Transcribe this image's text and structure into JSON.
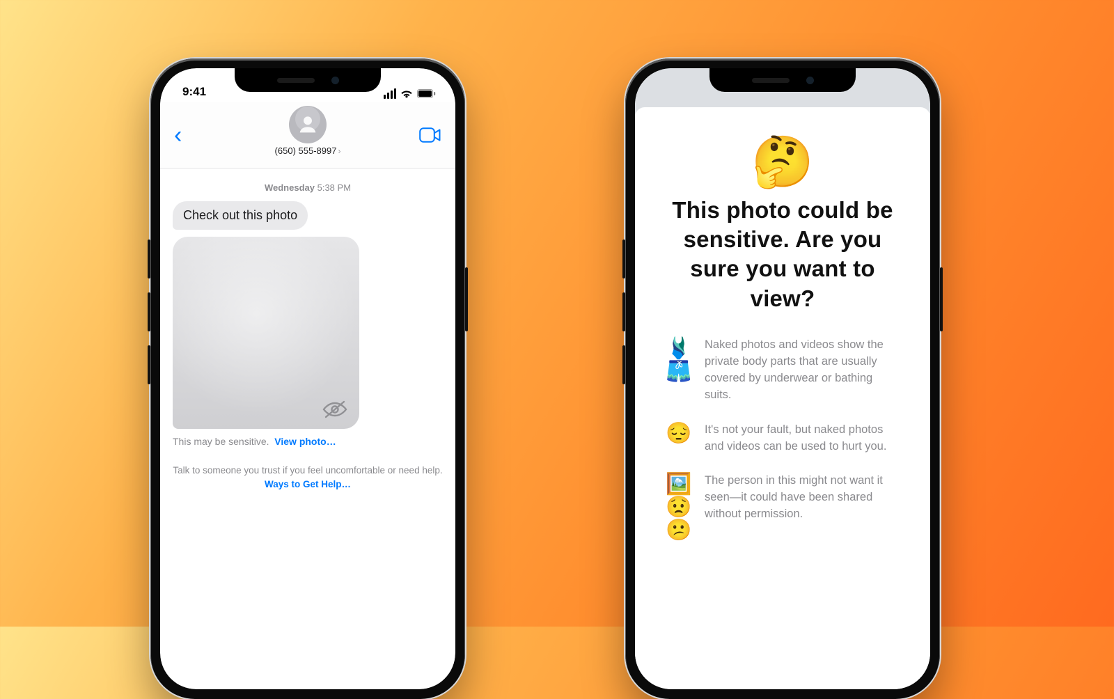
{
  "status": {
    "time": "9:41"
  },
  "messages": {
    "contact": "(650) 555-8997",
    "day": "Wednesday",
    "time": "5:38 PM",
    "bubble_text": "Check out this photo",
    "sensitive_label": "This may be sensitive.",
    "view_photo": "View photo…",
    "help_line": "Talk to someone you trust if you feel uncomfortable or need help.",
    "help_link": "Ways to Get Help…"
  },
  "sheet": {
    "emoji": "🤔",
    "headline": "This photo could be sensitive. Are you sure you want to view?",
    "points": [
      {
        "emoji": "🩱🩳",
        "text": "Naked photos and videos show the private body parts that are usually covered by underwear or bathing suits."
      },
      {
        "emoji": "😔",
        "text": "It's not your fault, but naked photos and videos can be used to hurt you."
      },
      {
        "emoji": "🖼️😟😕",
        "text": "The person in this might not want it seen—it could have been shared without permission."
      }
    ]
  }
}
